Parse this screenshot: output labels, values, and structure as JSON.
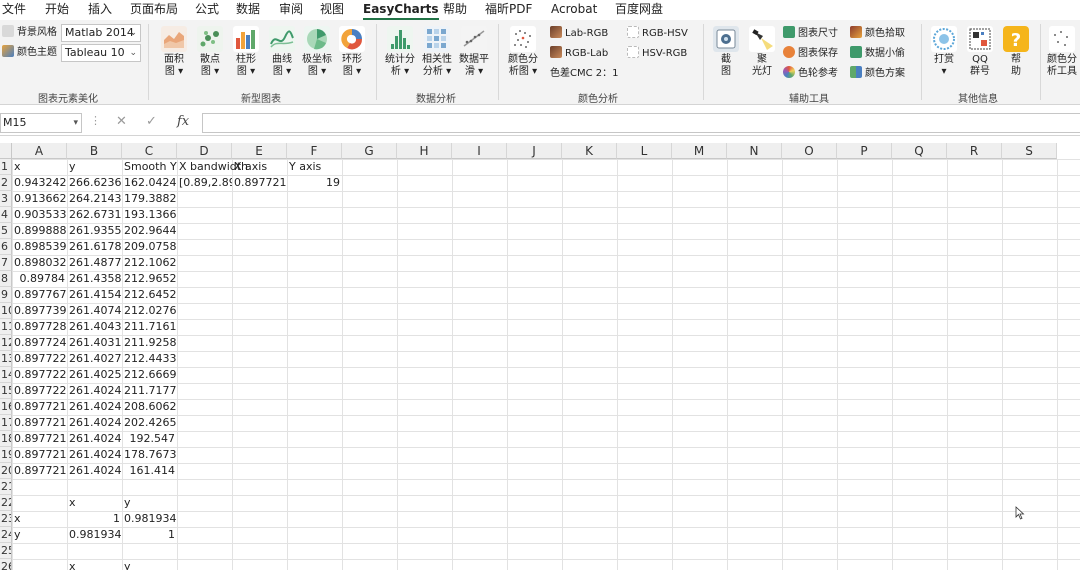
{
  "menu": [
    "文件",
    "开始",
    "插入",
    "页面布局",
    "公式",
    "数据",
    "审阅",
    "视图",
    "EasyCharts",
    "帮助",
    "福昕PDF",
    "Acrobat",
    "百度网盘"
  ],
  "menu_active": "EasyCharts",
  "ribbon": {
    "style_group": {
      "bg_style_label": "背景风格",
      "bg_style_value": "Matlab 2014",
      "color_theme_label": "颜色主题",
      "color_theme_value": "Tableau 10",
      "group_label": "图表元素美化"
    },
    "new_charts": {
      "buttons": [
        {
          "line1": "面积",
          "line2": "图 ▾"
        },
        {
          "line1": "散点",
          "line2": "图 ▾"
        },
        {
          "line1": "柱形",
          "line2": "图 ▾"
        },
        {
          "line1": "曲线",
          "line2": "图 ▾"
        },
        {
          "line1": "极坐标",
          "line2": "图 ▾"
        },
        {
          "line1": "环形",
          "line2": "图 ▾"
        }
      ],
      "group_label": "新型图表"
    },
    "data_analysis": {
      "buttons": [
        {
          "line1": "统计分",
          "line2": "析 ▾"
        },
        {
          "line1": "相关性",
          "line2": "分析 ▾"
        },
        {
          "line1": "数据平",
          "line2": "滑 ▾"
        }
      ],
      "group_label": "数据分析"
    },
    "color_analysis": {
      "big_button": {
        "line1": "颜色分",
        "line2": "析图 ▾"
      },
      "lab_rgb": "Lab-RGB",
      "rgb_lab": "RGB-Lab",
      "rgb_hsv": "RGB-HSV",
      "hsv_rgb": "HSV-RGB",
      "cmc": "色差CMC 2：1",
      "group_label": "颜色分析"
    },
    "aux_tools": {
      "screenshot": {
        "line1": "截",
        "line2": "图"
      },
      "spotlight": {
        "line1": "聚",
        "line2": "光灯"
      },
      "chart_size": "图表尺寸",
      "chart_save": "图表保存",
      "color_wheel": "色轮参考",
      "color_pick": "颜色拾取",
      "data_thief": "数据小偷",
      "color_scheme": "颜色方案",
      "group_label": "辅助工具"
    },
    "other_info": {
      "reward": {
        "line1": "打赏",
        "line2": "▾"
      },
      "qq": {
        "line1": "QQ",
        "line2": "群号"
      },
      "help": {
        "line1": "帮",
        "line2": "助"
      },
      "group_label": "其他信息"
    },
    "color_tool": {
      "line1": "颜色分",
      "line2": "析工具"
    }
  },
  "formula_bar": {
    "name_box": "M15",
    "formula": ""
  },
  "sheet": {
    "columns": [
      "A",
      "B",
      "C",
      "D",
      "E",
      "F",
      "G",
      "H",
      "I",
      "J",
      "K",
      "L",
      "M",
      "N",
      "O",
      "P",
      "Q",
      "R",
      "S"
    ],
    "row_labels": [
      "1",
      "2",
      "3",
      "4",
      "5",
      "6",
      "7",
      "8",
      "9",
      "10",
      "11",
      "12",
      "13",
      "14",
      "15",
      "16",
      "17",
      "18",
      "19",
      "20",
      "21",
      "22",
      "23",
      "24",
      "25",
      "26"
    ],
    "header_row": [
      "x",
      "y",
      "Smooth Y",
      "X bandwidth",
      "X axis",
      "Y axis"
    ],
    "row2_extra": {
      "d": "[0.89,2.89]",
      "e": "0.897721",
      "f": "19"
    },
    "data_rows": [
      [
        "0.943242",
        "266.6236",
        "162.0424"
      ],
      [
        "0.913662",
        "264.2143",
        "179.3882"
      ],
      [
        "0.903533",
        "262.6731",
        "193.1366"
      ],
      [
        "0.899888",
        "261.9355",
        "202.9644"
      ],
      [
        "0.898539",
        "261.6178",
        "209.0758"
      ],
      [
        "0.898032",
        "261.4877",
        "212.1062"
      ],
      [
        "0.89784",
        "261.4358",
        "212.9652"
      ],
      [
        "0.897767",
        "261.4154",
        "212.6452"
      ],
      [
        "0.897739",
        "261.4074",
        "212.0276"
      ],
      [
        "0.897728",
        "261.4043",
        "211.7161"
      ],
      [
        "0.897724",
        "261.4031",
        "211.9258"
      ],
      [
        "0.897722",
        "261.4027",
        "212.4433"
      ],
      [
        "0.897722",
        "261.4025",
        "212.6669"
      ],
      [
        "0.897722",
        "261.4024",
        "211.7177"
      ],
      [
        "0.897721",
        "261.4024",
        "208.6062"
      ],
      [
        "0.897721",
        "261.4024",
        "202.4265"
      ],
      [
        "0.897721",
        "261.4024",
        "192.547"
      ],
      [
        "0.897721",
        "261.4024",
        "178.7673"
      ],
      [
        "0.897721",
        "261.4024",
        "161.414"
      ]
    ],
    "corr_header": {
      "b": "x",
      "c": "y"
    },
    "corr_rows": [
      {
        "a": "x",
        "b": "1",
        "c": "0.981934"
      },
      {
        "a": "y",
        "b": "0.981934",
        "c": "1"
      }
    ],
    "row26": {
      "b": "x",
      "c": "y"
    }
  }
}
